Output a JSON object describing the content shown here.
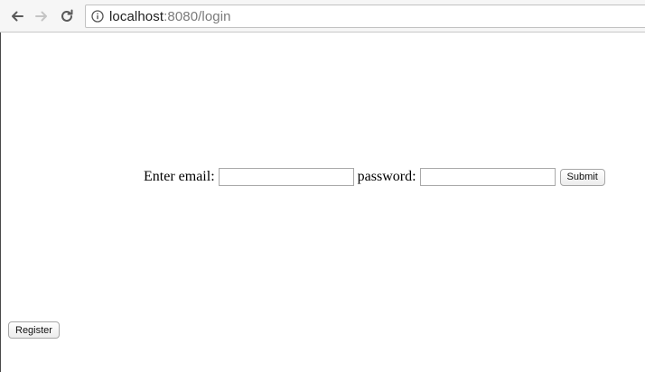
{
  "browser": {
    "url_host": "localhost",
    "url_rest": ":8080/login"
  },
  "login_form": {
    "email_label": "Enter email:",
    "email_value": "",
    "password_label": "password:",
    "password_value": "",
    "submit_label": "Submit"
  },
  "register": {
    "label": "Register"
  }
}
